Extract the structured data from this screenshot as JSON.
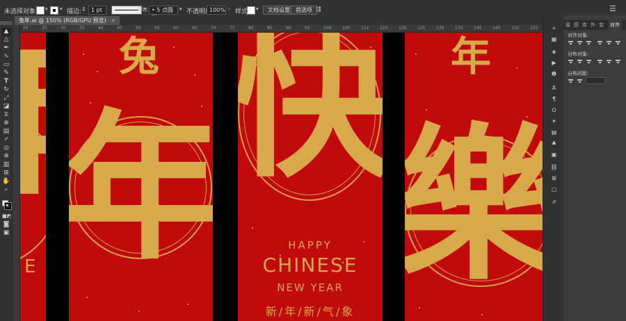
{
  "control_bar": {
    "selection_label": "未选择对象",
    "stroke_label": "描边:",
    "stroke_value": "1 pt",
    "profile_label": "等比",
    "brush_label": "5 点圆形",
    "opacity_label": "不透明度",
    "opacity_value": "100%",
    "style_label": "样式",
    "doc_setup_button": "文档设置",
    "preferences_button": "首选项"
  },
  "document_tab": {
    "title": "兔年.ai @ 150% (RGB/GPU 预览)",
    "close": "×"
  },
  "ruler_h": {
    "marks": [
      "20",
      "25",
      "30",
      "35",
      "40",
      "45",
      "50",
      "55",
      "60",
      "65",
      "70",
      "75",
      "80",
      "85",
      "90",
      "95",
      "100",
      "105",
      "110",
      "115",
      "120",
      "125",
      "130",
      "135",
      "140",
      "145",
      "150",
      "155"
    ]
  },
  "toolbar": {
    "tools": [
      "selection",
      "direct-selection",
      "pen",
      "curvature",
      "pencil",
      "rectangle",
      "type",
      "rotate",
      "scale",
      "width",
      "eraser",
      "shape-builder",
      "gradient",
      "eyedropper",
      "blend",
      "symbol-sprayer",
      "graph",
      "artboard",
      "slice",
      "hand",
      "zoom"
    ]
  },
  "canvas": {
    "colors": {
      "red": "#c00a0b",
      "gold": "#d8a94a",
      "black": "#000000"
    },
    "panel1": {
      "big_char": "年",
      "edge_letter": "E"
    },
    "panel2": {
      "top_char": "兔",
      "big_char": "年"
    },
    "panel3": {
      "big_char": "快",
      "line1": "HAPPY",
      "line2": "CHINESE",
      "line3": "NEW YEAR",
      "line4": "新/年/新/气/象"
    },
    "panel4": {
      "top_char": "年",
      "big_char": "樂"
    }
  },
  "right_panel": {
    "tabs": [
      "属",
      "图",
      "库",
      "外",
      "变",
      "对齐"
    ],
    "align_objects_label": "对齐对象:",
    "distribute_objects_label": "分布对象:",
    "distribute_spacing_label": "分布间距:"
  }
}
